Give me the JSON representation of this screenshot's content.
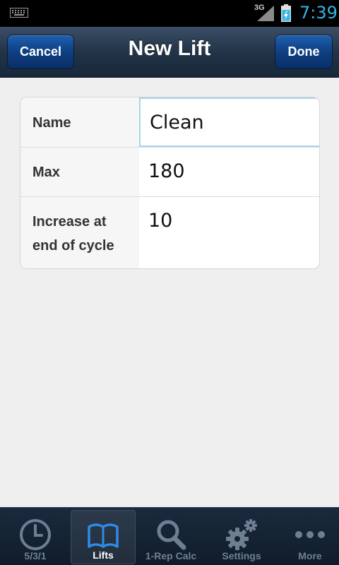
{
  "status_bar": {
    "network": "3G",
    "time": "7:39",
    "icons": [
      "keyboard-icon",
      "signal-icon",
      "battery-charging-icon"
    ],
    "clock_color": "#33b5e5"
  },
  "nav": {
    "title": "New Lift",
    "cancel_label": "Cancel",
    "done_label": "Done"
  },
  "form": {
    "fields": [
      {
        "label": "Name",
        "value": "Clean"
      },
      {
        "label": "Max",
        "value": "180"
      },
      {
        "label": "Increase at\nend of cycle",
        "value": "10"
      }
    ],
    "focus_color": "#a8d3ea"
  },
  "tabs": [
    {
      "label": "5/3/1",
      "icon": "clock-icon"
    },
    {
      "label": "Lifts",
      "icon": "book-icon",
      "active": true
    },
    {
      "label": "1-Rep Calc",
      "icon": "magnifier-icon"
    },
    {
      "label": "Settings",
      "icon": "gears-icon"
    },
    {
      "label": "More",
      "icon": "more-dots-icon"
    }
  ],
  "colors": {
    "accent": "#33b5e5",
    "active_tab_icon": "#2f8be8",
    "nav_button": "#0f3f82"
  }
}
